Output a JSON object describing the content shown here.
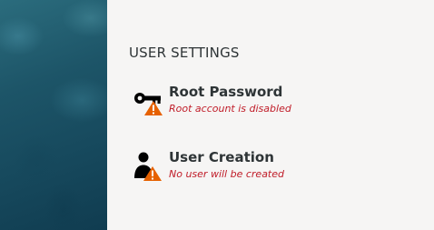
{
  "colors": {
    "status_warning_text": "#c01c28",
    "warning_badge": "#e66100",
    "heading_text": "#2e3436",
    "background": "#f6f5f4",
    "side_panel": "#1d5568"
  },
  "user_settings": {
    "heading": "USER SETTINGS",
    "spokes": [
      {
        "title": "Root Password",
        "status": "Root account is disabled",
        "icon": "key-icon",
        "badge": "warning-icon"
      },
      {
        "title": "User Creation",
        "status": "No user will be created",
        "icon": "user-icon",
        "badge": "warning-icon"
      }
    ]
  }
}
